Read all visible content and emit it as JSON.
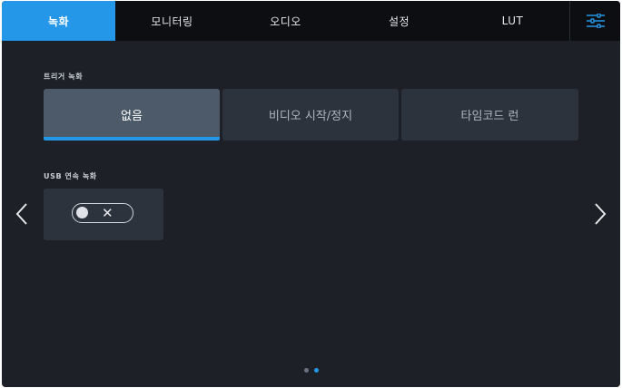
{
  "tabs": [
    {
      "label": "녹화",
      "active": true
    },
    {
      "label": "모니터링",
      "active": false
    },
    {
      "label": "오디오",
      "active": false
    },
    {
      "label": "설정",
      "active": false
    },
    {
      "label": "LUT",
      "active": false
    }
  ],
  "trigger_section": {
    "label": "트리거 녹화",
    "options": [
      "없음",
      "비디오 시작/정지",
      "타임코드 런"
    ],
    "selected": "없음"
  },
  "usb_section": {
    "label": "USB 연속 녹화",
    "toggle_state": "off",
    "toggle_symbol": "✕"
  },
  "pagination": {
    "pages": 2,
    "current": 2
  },
  "icons": {
    "settings": "sliders-icon",
    "prev": "chevron-left-icon",
    "next": "chevron-right-icon"
  },
  "colors": {
    "accent": "#2597e8",
    "background": "#1d2127",
    "tabbar": "#0c0e11",
    "button": "#2c333c",
    "button_selected": "#4d5a6a"
  }
}
